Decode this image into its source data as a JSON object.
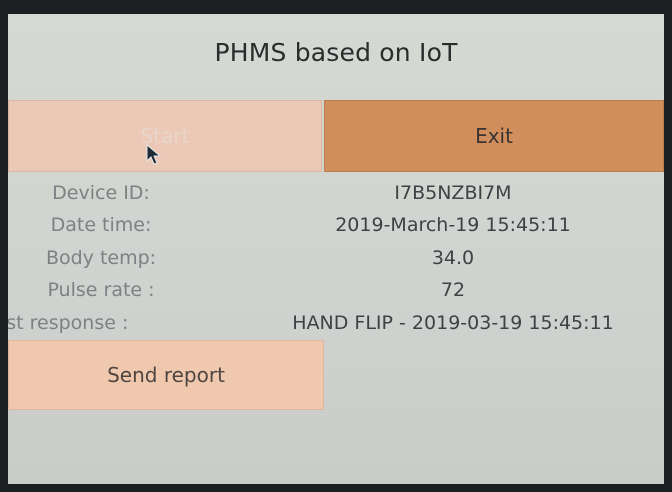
{
  "window": {
    "title": "PHMS based on IoT"
  },
  "buttons": {
    "start_label": "Start",
    "exit_label": "Exit",
    "send_report_label": "Send report"
  },
  "info": [
    {
      "label": "Device ID:",
      "value": "I7B5NZBI7M"
    },
    {
      "label": "Date time:",
      "value": "2019-March-19 15:45:11"
    },
    {
      "label": "Body temp:",
      "value": "34.0"
    },
    {
      "label": "Pulse rate :",
      "value": "72"
    },
    {
      "label": "Last response :",
      "value": "HAND FLIP - 2019-03-19 15:45:11"
    }
  ],
  "icons": {
    "cursor": "mouse-pointer-icon"
  },
  "colors": {
    "screen_bg": "#d3d6d2",
    "start_disabled": "#ecc9b6",
    "exit_button": "#cf8e5c",
    "send_report_button": "#f0c8ad"
  }
}
